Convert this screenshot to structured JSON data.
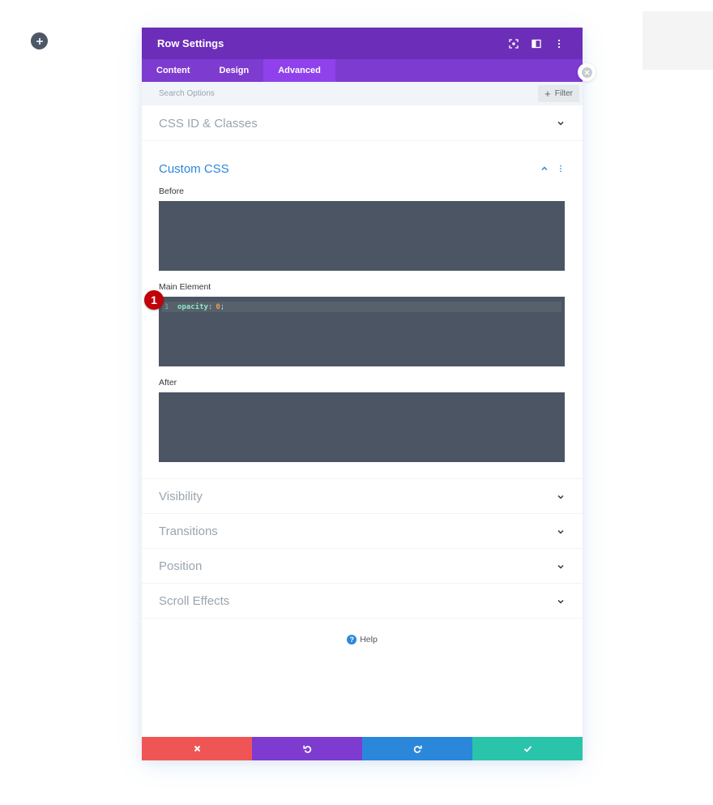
{
  "page": {
    "add_button_icon": "plus-icon"
  },
  "modal": {
    "title": "Row Settings",
    "header_icons": [
      "screen-target-icon",
      "split-layout-icon",
      "more-vertical-icon"
    ],
    "tabs": [
      {
        "label": "Content",
        "active": false
      },
      {
        "label": "Design",
        "active": false
      },
      {
        "label": "Advanced",
        "active": true
      }
    ],
    "search": {
      "placeholder": "Search Options",
      "filter_label": "Filter"
    },
    "sections": {
      "css_id": {
        "title": "CSS ID & Classes",
        "expanded": false
      },
      "custom_css": {
        "title": "Custom CSS",
        "expanded": true,
        "fields": {
          "before": {
            "label": "Before",
            "value": ""
          },
          "main_element": {
            "label": "Main Element",
            "line_number": "1",
            "property": "opacity",
            "colon": ":",
            "value": "0",
            "semicolon": ";"
          },
          "after": {
            "label": "After",
            "value": ""
          }
        }
      },
      "visibility": {
        "title": "Visibility",
        "expanded": false
      },
      "transitions": {
        "title": "Transitions",
        "expanded": false
      },
      "position": {
        "title": "Position",
        "expanded": false
      },
      "scroll_effects": {
        "title": "Scroll Effects",
        "expanded": false
      }
    },
    "help_label": "Help",
    "footer": {
      "buttons": [
        "cancel",
        "undo",
        "redo",
        "save"
      ]
    }
  },
  "annotation": {
    "step_number": "1"
  },
  "colors": {
    "header": "#6c2eb9",
    "tabs": "#7e3bd0",
    "active_tab": "#8f42ec",
    "accent_blue": "#2b87da",
    "code_bg": "#4b5563",
    "cancel": "#ef5555",
    "undo": "#7e3bd0",
    "redo": "#2b87da",
    "save": "#29c4a9",
    "badge": "#c0000a"
  }
}
